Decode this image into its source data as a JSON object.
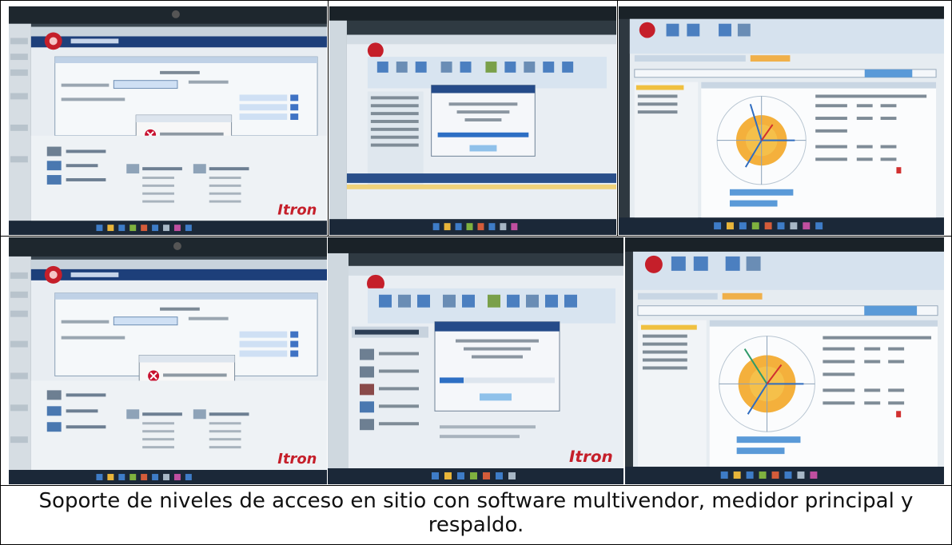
{
  "caption": "Soporte de niveles de acceso en sitio con software multivendor, medidor principal y respaldo.",
  "photos": [
    {
      "id": "photo-1",
      "brand": "Itron",
      "scene": "itron-error-dialog"
    },
    {
      "id": "photo-2",
      "scene": "software-progress-dialog"
    },
    {
      "id": "photo-3",
      "scene": "phasor-diagram"
    },
    {
      "id": "photo-4",
      "brand": "Itron",
      "scene": "itron-error-dialog"
    },
    {
      "id": "photo-5",
      "brand": "Itron",
      "scene": "software-progress-dialog"
    },
    {
      "id": "photo-6",
      "scene": "phasor-diagram"
    }
  ],
  "colors": {
    "bezel": "#2e3b45",
    "title_bar": "#1d3f7a",
    "window_bg": "#e9eef3",
    "dialog_error_icon": "#c8102e",
    "itron_red": "#c51f2a",
    "phasor_orange": "#f2a21a",
    "taskbar": "#1b2838"
  }
}
